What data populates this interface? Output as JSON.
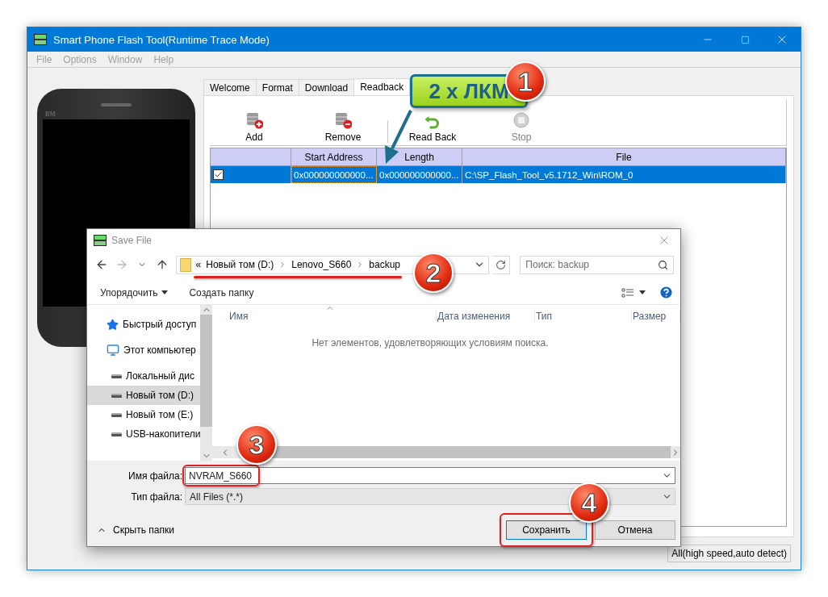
{
  "window": {
    "title": "Smart Phone Flash Tool(Runtime Trace Mode)"
  },
  "menu": [
    {
      "label": "File",
      "disabled": true
    },
    {
      "label": "Options",
      "disabled": true
    },
    {
      "label": "Window",
      "disabled": true
    },
    {
      "label": "Help",
      "disabled": true
    }
  ],
  "phone": {
    "label": "BM"
  },
  "tabs": [
    {
      "label": "Welcome",
      "selected": false
    },
    {
      "label": "Format",
      "selected": false
    },
    {
      "label": "Download",
      "selected": false
    },
    {
      "label": "Readback",
      "selected": true
    }
  ],
  "toolbar": [
    {
      "kind": "add",
      "label": "Add",
      "disabled": false
    },
    {
      "kind": "remove",
      "label": "Remove",
      "disabled": false
    },
    {
      "kind": "readback",
      "label": "Read Back",
      "disabled": false
    },
    {
      "kind": "stop",
      "label": "Stop",
      "disabled": true
    }
  ],
  "table": {
    "columns": [
      "Start Address",
      "Length",
      "File"
    ],
    "rows": [
      {
        "checked": true,
        "selected": true,
        "start_address": "0x000000000000...",
        "length": "0x000000000000...",
        "file": "C:\\SP_Flash_Tool_v5.1712_Win\\ROM_0"
      }
    ]
  },
  "status_bar": {
    "text": "All(high speed,auto detect)"
  },
  "dialog": {
    "title": "Save File",
    "breadcrumb": [
      "«",
      "Новый том (D:)",
      "Lenovo_S660",
      "backup"
    ],
    "search": {
      "placeholder": "Поиск: backup"
    },
    "commands": [
      "Упорядочить",
      "Создать папку"
    ],
    "nav_items": [
      {
        "kind": "quick",
        "label": "Быстрый доступ",
        "selected": false
      },
      {
        "kind": "computer",
        "label": "Этот компьютер",
        "selected": false
      },
      {
        "kind": "drive",
        "label": "Локальный дис",
        "selected": false
      },
      {
        "kind": "drive",
        "label": "Новый том (D:)",
        "selected": true
      },
      {
        "kind": "drive",
        "label": "Новый том (E:)",
        "selected": false
      },
      {
        "kind": "drive",
        "label": "USB-накопители",
        "selected": false
      }
    ],
    "columns": [
      "Имя",
      "Дата изменения",
      "Тип",
      "Размер"
    ],
    "empty_message": "Нет элементов, удовлетворяющих условиям поиска.",
    "file_name": {
      "label": "Имя файла:",
      "value": "NVRAM_S660"
    },
    "file_type": {
      "label": "Тип файла:",
      "value": "All Files (*.*)"
    },
    "hide_folders": "Скрыть папки",
    "buttons": [
      {
        "label": "Сохранить",
        "default": true
      },
      {
        "label": "Отмена",
        "default": false
      }
    ]
  },
  "annotations": [
    {
      "kind": "callout",
      "label": "2 x ЛКМ"
    },
    {
      "kind": "badge",
      "label": "1"
    },
    {
      "kind": "badge",
      "label": "2"
    },
    {
      "kind": "badge",
      "label": "3"
    },
    {
      "kind": "badge",
      "label": "4"
    }
  ]
}
